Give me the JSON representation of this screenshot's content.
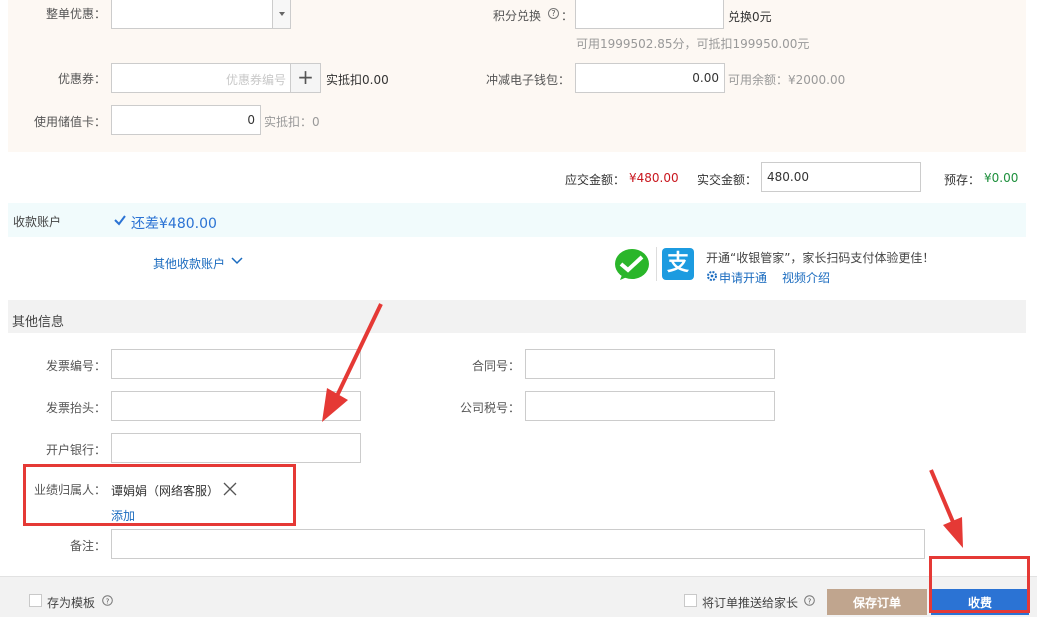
{
  "discount": {
    "whole_order_label": "整单优惠：",
    "points_label": "积分兑换",
    "points_help": "?",
    "points_colon": "：",
    "points_value": "",
    "points_redeem": "兑换0元",
    "points_available": "可用1999502.85分，可抵扣199950.00元",
    "coupon_label": "优惠券：",
    "coupon_placeholder": "优惠券编号",
    "coupon_add": "+",
    "coupon_deduct": "实抵扣0.00",
    "wallet_label": "冲减电子钱包：",
    "wallet_value": "0.00",
    "wallet_balance": "可用余额：¥2000.00",
    "card_label": "使用储值卡：",
    "card_value": "0",
    "card_deduct": "实抵扣：0"
  },
  "totals": {
    "due_label": "应交金额：",
    "due_value": "¥480.00",
    "paid_label": "实交金额：",
    "paid_value": "480.00",
    "deposit_label": "预存：",
    "deposit_value": "¥0.00"
  },
  "account": {
    "title": "收款账户",
    "owed": "还差¥480.00",
    "other_accounts": "其他收款账户",
    "promo": "开通“收银管家”，家长扫码支付体验更佳！",
    "apply": "申请开通",
    "video": "视频介绍"
  },
  "other_info": {
    "title": "其他信息",
    "invoice_no_label": "发票编号：",
    "contract_no_label": "合同号：",
    "invoice_title_label": "发票抬头：",
    "tax_no_label": "公司税号：",
    "bank_label": "开户银行：",
    "owner_label": "业绩归属人：",
    "owner_name": "谭娟娟（网络客服）",
    "add_link": "添加",
    "remark_label": "备注："
  },
  "footer": {
    "save_template": "存为模板",
    "push_parent": "将订单推送给家长",
    "save_order": "保存订单",
    "collect": "收费"
  },
  "colors": {
    "save_order_bg": "#c0a58e",
    "collect_bg": "#2b73d4",
    "highlight": "#e53935",
    "wechat": "#2ab62a",
    "alipay": "#1c9be0"
  }
}
